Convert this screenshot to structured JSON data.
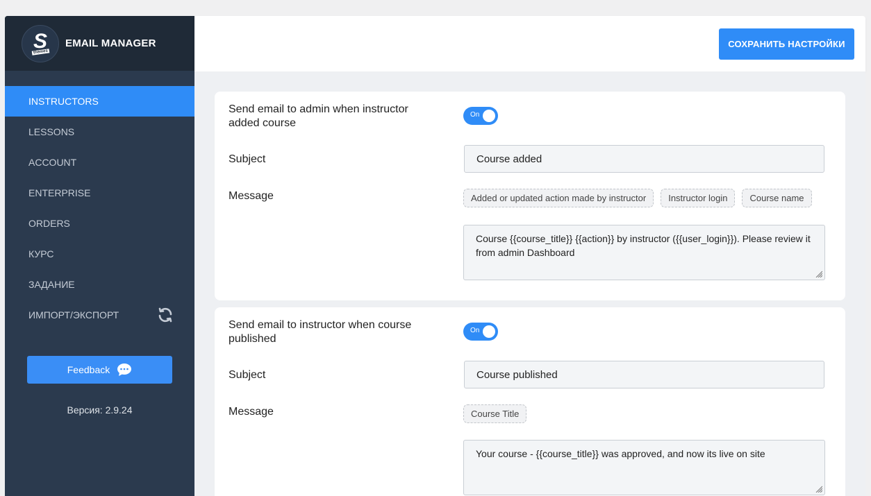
{
  "brand": {
    "logo_letter": "S",
    "logo_tag": "themes",
    "title": "EMAIL MANAGER"
  },
  "nav": {
    "items": [
      {
        "label": "INSTRUCTORS",
        "active": true
      },
      {
        "label": "LESSONS"
      },
      {
        "label": "ACCOUNT"
      },
      {
        "label": "ENTERPRISE"
      },
      {
        "label": "ORDERS"
      },
      {
        "label": "КУРС"
      },
      {
        "label": "ЗАДАНИЕ"
      },
      {
        "label": "ИМПОРТ/ЭКСПОРТ",
        "icon": "refresh-icon"
      }
    ]
  },
  "feedback": {
    "label": "Feedback",
    "icon": "chat-bubble-icon"
  },
  "version": "Версия: 2.9.24",
  "toolbar": {
    "save_label": "СОХРАНИТЬ НАСТРОЙКИ"
  },
  "colors": {
    "accent": "#2f8cf7",
    "sidebar": "#2b3a4e",
    "sidebar_header": "#1f2a37"
  },
  "settings": [
    {
      "title": "Send email to admin when instructor added course",
      "toggle": "On",
      "subject_label": "Subject",
      "subject_value": "Course added",
      "message_label": "Message",
      "tags": [
        "Added or updated action made by instructor",
        "Instructor login",
        "Course name"
      ],
      "message_value": "Course {{course_title}} {{action}} by instructor ({{user_login}}). Please review it from admin Dashboard"
    },
    {
      "title": "Send email to instructor when course published",
      "toggle": "On",
      "subject_label": "Subject",
      "subject_value": "Course published",
      "message_label": "Message",
      "tags": [
        "Course Title"
      ],
      "message_value": "Your course - {{course_title}} was approved, and now its live on site"
    }
  ]
}
